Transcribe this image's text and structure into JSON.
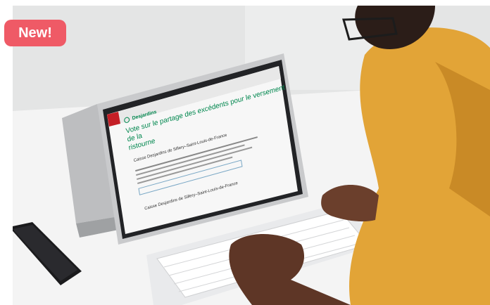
{
  "badge": {
    "label": "New!"
  },
  "screen": {
    "logo": "Desjardins",
    "title_line1": "Vote sur le partage des excédents pour le versement de la",
    "title_line2": "ristourne",
    "section1": "Caisse Desjardins de Sillery–Saint-Louis-de-France",
    "section2": "Caisse Desjardins de Sillery–Saint-Louis-de-France"
  },
  "colors": {
    "badge": "#ef5a66",
    "brand_green": "#00874e",
    "sweater": "#e2a437"
  }
}
